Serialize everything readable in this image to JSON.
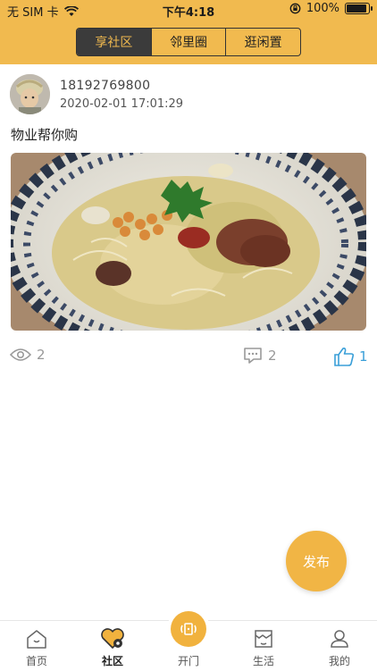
{
  "status_bar": {
    "carrier": "无 SIM 卡",
    "time": "下午4:18",
    "battery": "100%"
  },
  "segments": [
    {
      "label": "享社区",
      "active": true
    },
    {
      "label": "邻里圈",
      "active": false
    },
    {
      "label": "逛闲置",
      "active": false
    }
  ],
  "post": {
    "username": "18192769800",
    "timestamp": "2020-02-01 17:01:29",
    "content": "物业帮你购",
    "views": "2",
    "comments": "2",
    "likes": "1"
  },
  "publish_label": "发布",
  "tabbar": {
    "home": "首页",
    "community": "社区",
    "open_door": "开门",
    "life": "生活",
    "mine": "我的"
  },
  "colors": {
    "accent": "#f1ba4f",
    "like": "#3a9fd8"
  }
}
